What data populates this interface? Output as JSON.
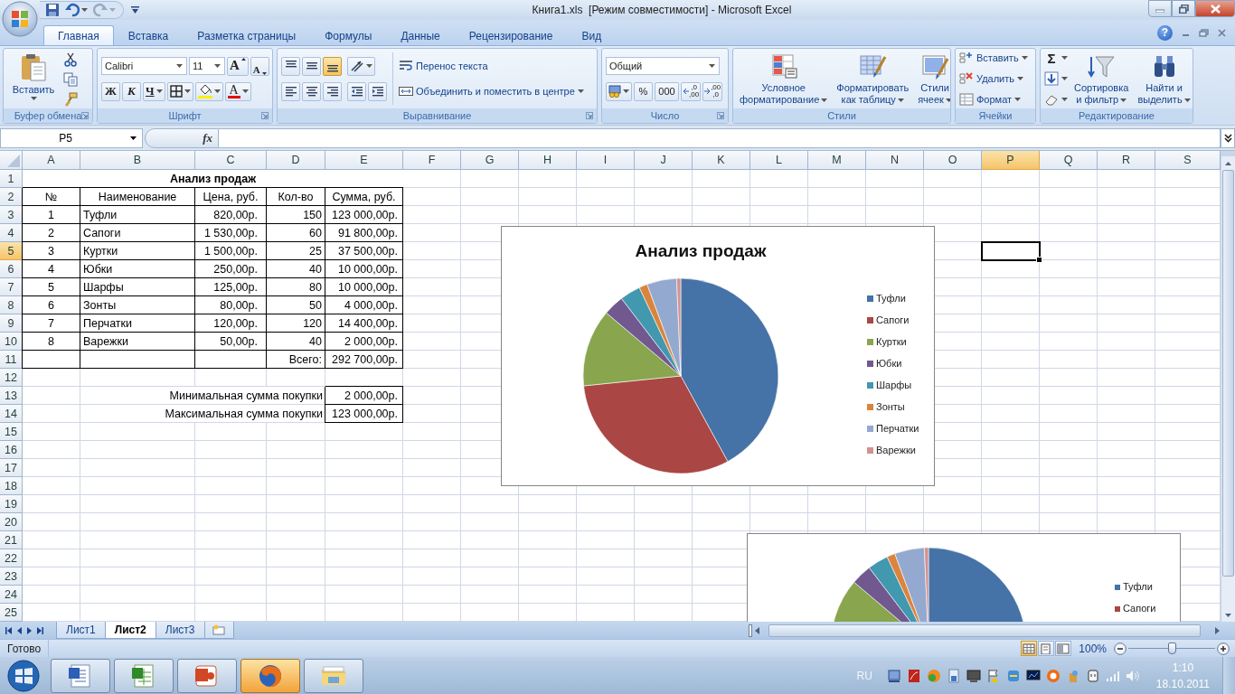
{
  "window": {
    "title": "Книга1.xls  [Режим совместимости] - Microsoft Excel"
  },
  "ribbon_tabs": [
    {
      "label": "Главная",
      "selected": true
    },
    {
      "label": "Вставка",
      "selected": false
    },
    {
      "label": "Разметка страницы",
      "selected": false
    },
    {
      "label": "Формулы",
      "selected": false
    },
    {
      "label": "Данные",
      "selected": false
    },
    {
      "label": "Рецензирование",
      "selected": false
    },
    {
      "label": "Вид",
      "selected": false
    }
  ],
  "help": "?",
  "ribbon": {
    "clipboard": {
      "label": "Буфер обмена",
      "paste": "Вставить"
    },
    "font": {
      "label": "Шрифт",
      "name": "Calibri",
      "size": "11",
      "grow": "A",
      "shrink": "A",
      "bold": "Ж",
      "italic": "К",
      "underline": "Ч",
      "color_button": "A"
    },
    "alignment": {
      "label": "Выравнивание",
      "vertical": [
        {
          "selected": false
        },
        {
          "selected": false
        },
        {
          "selected": true
        }
      ],
      "horizontal": [
        {
          "selected": false
        },
        {
          "selected": false
        },
        {
          "selected": false
        }
      ],
      "wrap": "Перенос текста",
      "merge": "Объединить и поместить в центре"
    },
    "number": {
      "label": "Число",
      "format": "Общий",
      "percent": "%",
      "thousands": "000",
      "decimals": [
        {
          "top": ",0",
          "bottom": ",00"
        },
        {
          "top": ",00",
          "bottom": ",0"
        }
      ]
    },
    "styles": {
      "label": "Стили",
      "buttons": [
        {
          "kind": "conditional",
          "label": "Условное\nформатирование"
        },
        {
          "kind": "table",
          "label": "Форматировать\nкак таблицу"
        },
        {
          "kind": "cell",
          "label": "Стили\nячеек"
        }
      ]
    },
    "cells": {
      "label": "Ячейки",
      "buttons": [
        {
          "kind": "insert",
          "label": "Вставить"
        },
        {
          "kind": "delete",
          "label": "Удалить"
        },
        {
          "kind": "format",
          "label": "Формат"
        }
      ]
    },
    "editing": {
      "label": "Редактирование",
      "sum": "Σ",
      "sort": "Сортировка\nи фильтр",
      "find": "Найти и\nвыделить"
    }
  },
  "formula_bar": {
    "name_box": "P5",
    "fx": "fx"
  },
  "sheet": {
    "columns": [
      {
        "label": "A",
        "selected": false
      },
      {
        "label": "B",
        "selected": false
      },
      {
        "label": "C",
        "selected": false
      },
      {
        "label": "D",
        "selected": false
      },
      {
        "label": "E",
        "selected": false
      },
      {
        "label": "F",
        "selected": false
      },
      {
        "label": "G",
        "selected": false
      },
      {
        "label": "H",
        "selected": false
      },
      {
        "label": "I",
        "selected": false
      },
      {
        "label": "J",
        "selected": false
      },
      {
        "label": "K",
        "selected": false
      },
      {
        "label": "L",
        "selected": false
      },
      {
        "label": "M",
        "selected": false
      },
      {
        "label": "N",
        "selected": false
      },
      {
        "label": "O",
        "selected": false
      },
      {
        "label": "P",
        "selected": true
      },
      {
        "label": "Q",
        "selected": false
      },
      {
        "label": "R",
        "selected": false
      },
      {
        "label": "S",
        "selected": false
      }
    ],
    "rows": [
      {
        "label": "1",
        "selected": false,
        "kind": "title",
        "text": "Анализ продаж"
      },
      {
        "label": "2",
        "selected": false,
        "kind": "header",
        "cells": [
          "№",
          "Наименование",
          "Цена, руб.",
          "Кол-во",
          "Сумма, руб."
        ]
      },
      {
        "label": "3",
        "selected": false,
        "kind": "item",
        "cells": [
          "1",
          "Туфли",
          "820,00р.",
          "150",
          "123 000,00р."
        ]
      },
      {
        "label": "4",
        "selected": false,
        "kind": "item",
        "cells": [
          "2",
          "Сапоги",
          "1 530,00р.",
          "60",
          "91 800,00р."
        ]
      },
      {
        "label": "5",
        "selected": true,
        "kind": "item",
        "cells": [
          "3",
          "Куртки",
          "1 500,00р.",
          "25",
          "37 500,00р."
        ]
      },
      {
        "label": "6",
        "selected": false,
        "kind": "item",
        "cells": [
          "4",
          "Юбки",
          "250,00р.",
          "40",
          "10 000,00р."
        ]
      },
      {
        "label": "7",
        "selected": false,
        "kind": "item",
        "cells": [
          "5",
          "Шарфы",
          "125,00р.",
          "80",
          "10 000,00р."
        ]
      },
      {
        "label": "8",
        "selected": false,
        "kind": "item",
        "cells": [
          "6",
          "Зонты",
          "80,00р.",
          "50",
          "4 000,00р."
        ]
      },
      {
        "label": "9",
        "selected": false,
        "kind": "item",
        "cells": [
          "7",
          "Перчатки",
          "120,00р.",
          "120",
          "14 400,00р."
        ]
      },
      {
        "label": "10",
        "selected": false,
        "kind": "item",
        "cells": [
          "8",
          "Варежки",
          "50,00р.",
          "40",
          "2 000,00р."
        ]
      },
      {
        "label": "11",
        "selected": false,
        "kind": "total",
        "caption": "Всего:",
        "value": "292 700,00р."
      },
      {
        "label": "12",
        "selected": false,
        "kind": "blank"
      },
      {
        "label": "13",
        "selected": false,
        "kind": "summary",
        "caption": "Минимальная сумма покупки",
        "value": "2 000,00р."
      },
      {
        "label": "14",
        "selected": false,
        "kind": "summary",
        "caption": "Максимальная сумма покупки",
        "value": "123 000,00р."
      },
      {
        "label": "15",
        "selected": false,
        "kind": "blank"
      },
      {
        "label": "16",
        "selected": false,
        "kind": "blank"
      },
      {
        "label": "17",
        "selected": false,
        "kind": "blank"
      },
      {
        "label": "18",
        "selected": false,
        "kind": "blank"
      },
      {
        "label": "19",
        "selected": false,
        "kind": "blank"
      },
      {
        "label": "20",
        "selected": false,
        "kind": "blank"
      },
      {
        "label": "21",
        "selected": false,
        "kind": "blank"
      },
      {
        "label": "22",
        "selected": false,
        "kind": "blank"
      },
      {
        "label": "23",
        "selected": false,
        "kind": "blank"
      },
      {
        "label": "24",
        "selected": false,
        "kind": "blank"
      },
      {
        "label": "25",
        "selected": false,
        "kind": "blank"
      }
    ]
  },
  "chart": {
    "chart_data": {
      "type": "pie",
      "title": "Анализ продаж",
      "categories": [
        "Туфли",
        "Сапоги",
        "Куртки",
        "Юбки",
        "Шарфы",
        "Зонты",
        "Перчатки",
        "Варежки"
      ],
      "values": [
        42.02,
        31.36,
        12.81,
        3.42,
        3.42,
        1.37,
        4.92,
        0.68
      ],
      "legend": "right",
      "colors": [
        "#4572a7",
        "#aa4643",
        "#89a54e",
        "#71588f",
        "#4198af",
        "#db843d",
        "#93a9cf",
        "#d19392"
      ]
    }
  },
  "chart_2": {
    "legend": [
      {
        "label": "Туфли",
        "color": "#4572a7"
      },
      {
        "label": "Сапоги",
        "color": "#aa4643"
      }
    ]
  },
  "sheet_tabs": [
    {
      "label": "Лист1",
      "selected": false
    },
    {
      "label": "Лист2",
      "selected": true
    },
    {
      "label": "Лист3",
      "selected": false
    }
  ],
  "status_bar": {
    "status": "Готово",
    "views": [
      {
        "selected": true
      },
      {
        "selected": false
      },
      {
        "selected": false
      }
    ],
    "zoom": "100%",
    "zoom_slider": {
      "level": 0.5
    }
  },
  "taskbar": {
    "apps": [
      {
        "kind": "word",
        "active": false
      },
      {
        "kind": "excel",
        "active": false
      },
      {
        "kind": "powerpoint",
        "active": false
      },
      {
        "kind": "firefox",
        "active": true
      },
      {
        "kind": "explorer",
        "active": false
      }
    ],
    "language": "RU",
    "time": "1:10",
    "date": "18.10.2011"
  }
}
